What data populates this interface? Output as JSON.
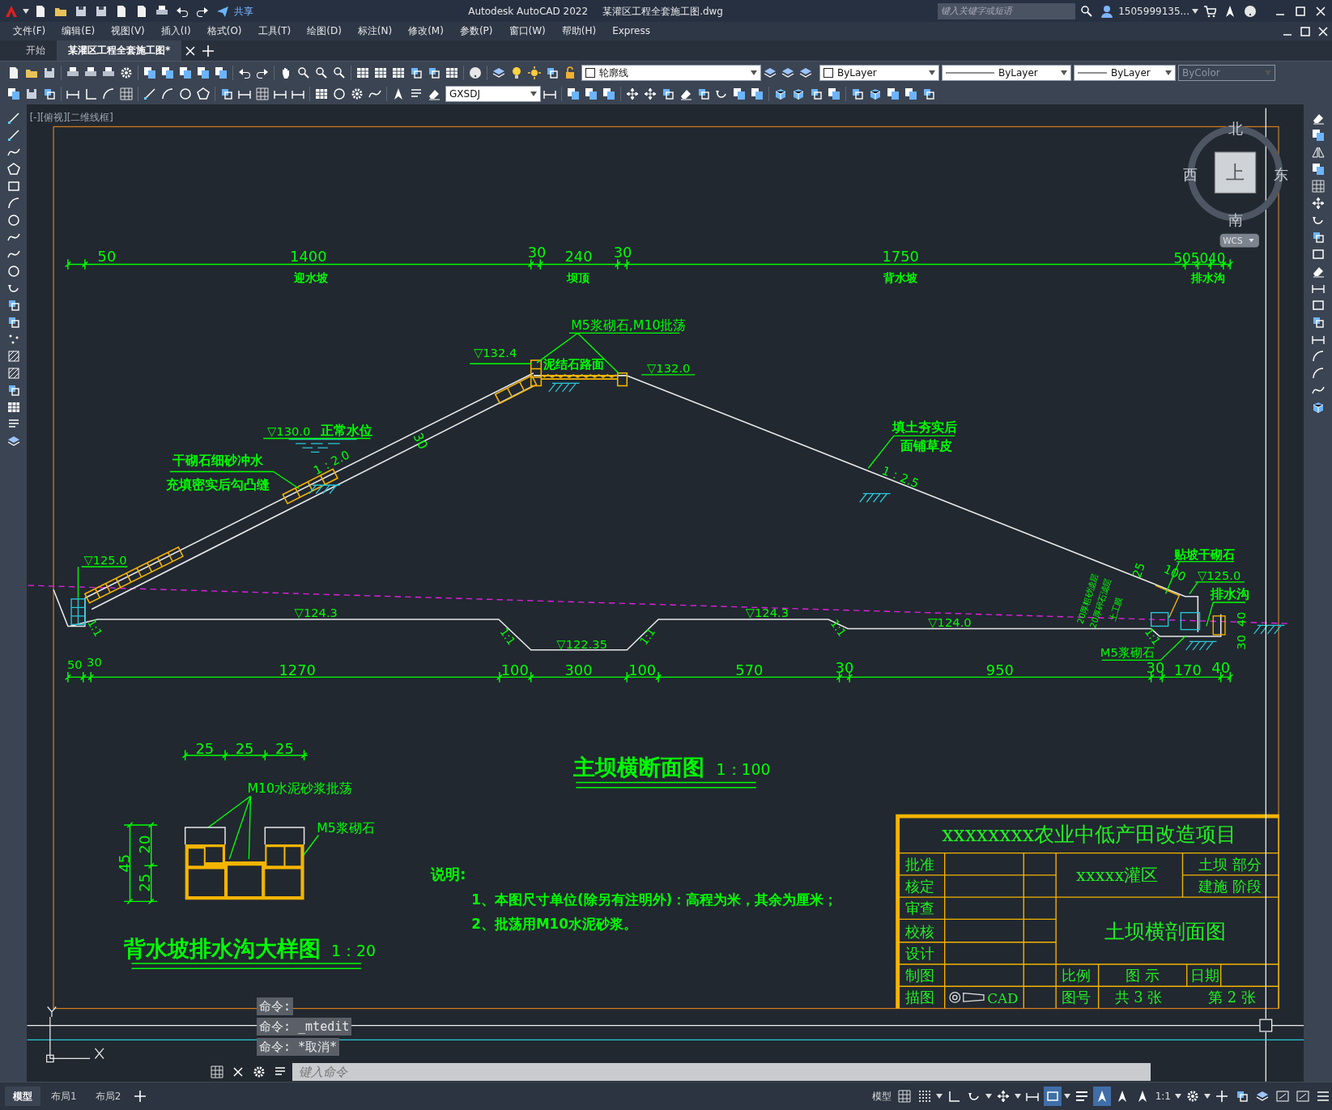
{
  "title_bar": {
    "share": "共享",
    "app": "Autodesk AutoCAD 2022",
    "file": "某灌区工程全套施工图.dwg",
    "search_placeholder": "键入关键字或短语",
    "user": "1505999135..."
  },
  "menu": [
    "文件(F)",
    "编辑(E)",
    "视图(V)",
    "插入(I)",
    "格式(O)",
    "工具(T)",
    "绘图(D)",
    "标注(N)",
    "修改(M)",
    "参数(P)",
    "窗口(W)",
    "帮助(H)",
    "Express"
  ],
  "doc_tabs": [
    {
      "label": "开始",
      "selected": false
    },
    {
      "label": "某灌区工程全套施工图*",
      "selected": true
    }
  ],
  "properties": {
    "layer": "轮廓线",
    "color_control": "ByLayer",
    "linetype": "ByLayer",
    "lineweight": "ByLayer",
    "plot_style": {
      "label": "ByColor",
      "disabled": true
    },
    "dim_style": "GXSDJ"
  },
  "viewport_label": "[-][俯视][二维线框]",
  "viewcube": {
    "north": "北",
    "south": "南",
    "west": "西",
    "east": "东",
    "face": "上",
    "ucs": "WCS"
  },
  "drawing": {
    "texts": [
      "50",
      "1400",
      "30",
      "240",
      "30",
      "1750",
      "505040",
      "迎水坡",
      "坝顶",
      "背水坡",
      "排水沟",
      "M5浆砌石,M10批荡",
      "▽132.4",
      "泥结石路面",
      "▽132.0",
      "▽130.0",
      "正常水位",
      "干砌石细砂冲水",
      "充填密实后勾凸缝",
      "1：2.0",
      "30",
      "填土夯实后",
      "面铺草皮",
      "1：2.5",
      "▽125.0",
      "▽124.3",
      "1:1",
      "1:1",
      "▽122.35",
      "1:1",
      "▽124.3",
      "1:1",
      "▽124.0",
      "贴坡干砌石",
      "25",
      "100",
      "▽125.0",
      "排水沟",
      "20厚粗砂滤层",
      "20厚碎石滤层",
      "土工膜",
      "1:1",
      "M5浆砌石",
      "30",
      "40",
      "50",
      "30",
      "1270",
      "100",
      "300",
      "100",
      "570",
      "30",
      "950",
      "30",
      "170",
      "40",
      "25",
      "25",
      "25",
      "M10水泥砂浆批荡",
      "M5浆砌石",
      "45",
      "20",
      "25",
      "背水坡排水沟大样图",
      "1：20",
      "主坝横断面图",
      "1：100",
      "说明:",
      "1、本图尺寸单位(除另有注明外)：高程为米，其余为厘米；",
      "2、批荡用M10水泥砂浆。"
    ]
  },
  "title_block": {
    "project": "xxxxxxxx农业中低产田改造项目",
    "roles": [
      "批准",
      "核定",
      "审查",
      "校核",
      "设计",
      "制图",
      "描图"
    ],
    "district": "xxxxx灌区",
    "part": "土坝 部分",
    "stage": "建施 阶段",
    "drawing_title": "土坝横剖面图",
    "scale_label": "比例",
    "legend_label": "图 示",
    "date_label": "日期",
    "number_label": "图号",
    "total": "共 3 张",
    "sheet": "第 2 张",
    "cad": "CAD"
  },
  "command_history": [
    "命令:",
    "命令: _mtedit",
    "命令: *取消*"
  ],
  "command_placeholder": "键入命令",
  "layout_tabs": [
    {
      "label": "模型",
      "selected": true
    },
    {
      "label": "布局1",
      "selected": false
    },
    {
      "label": "布局2",
      "selected": false
    }
  ],
  "status_bar": {
    "space": "模型",
    "scale": "1:1"
  }
}
